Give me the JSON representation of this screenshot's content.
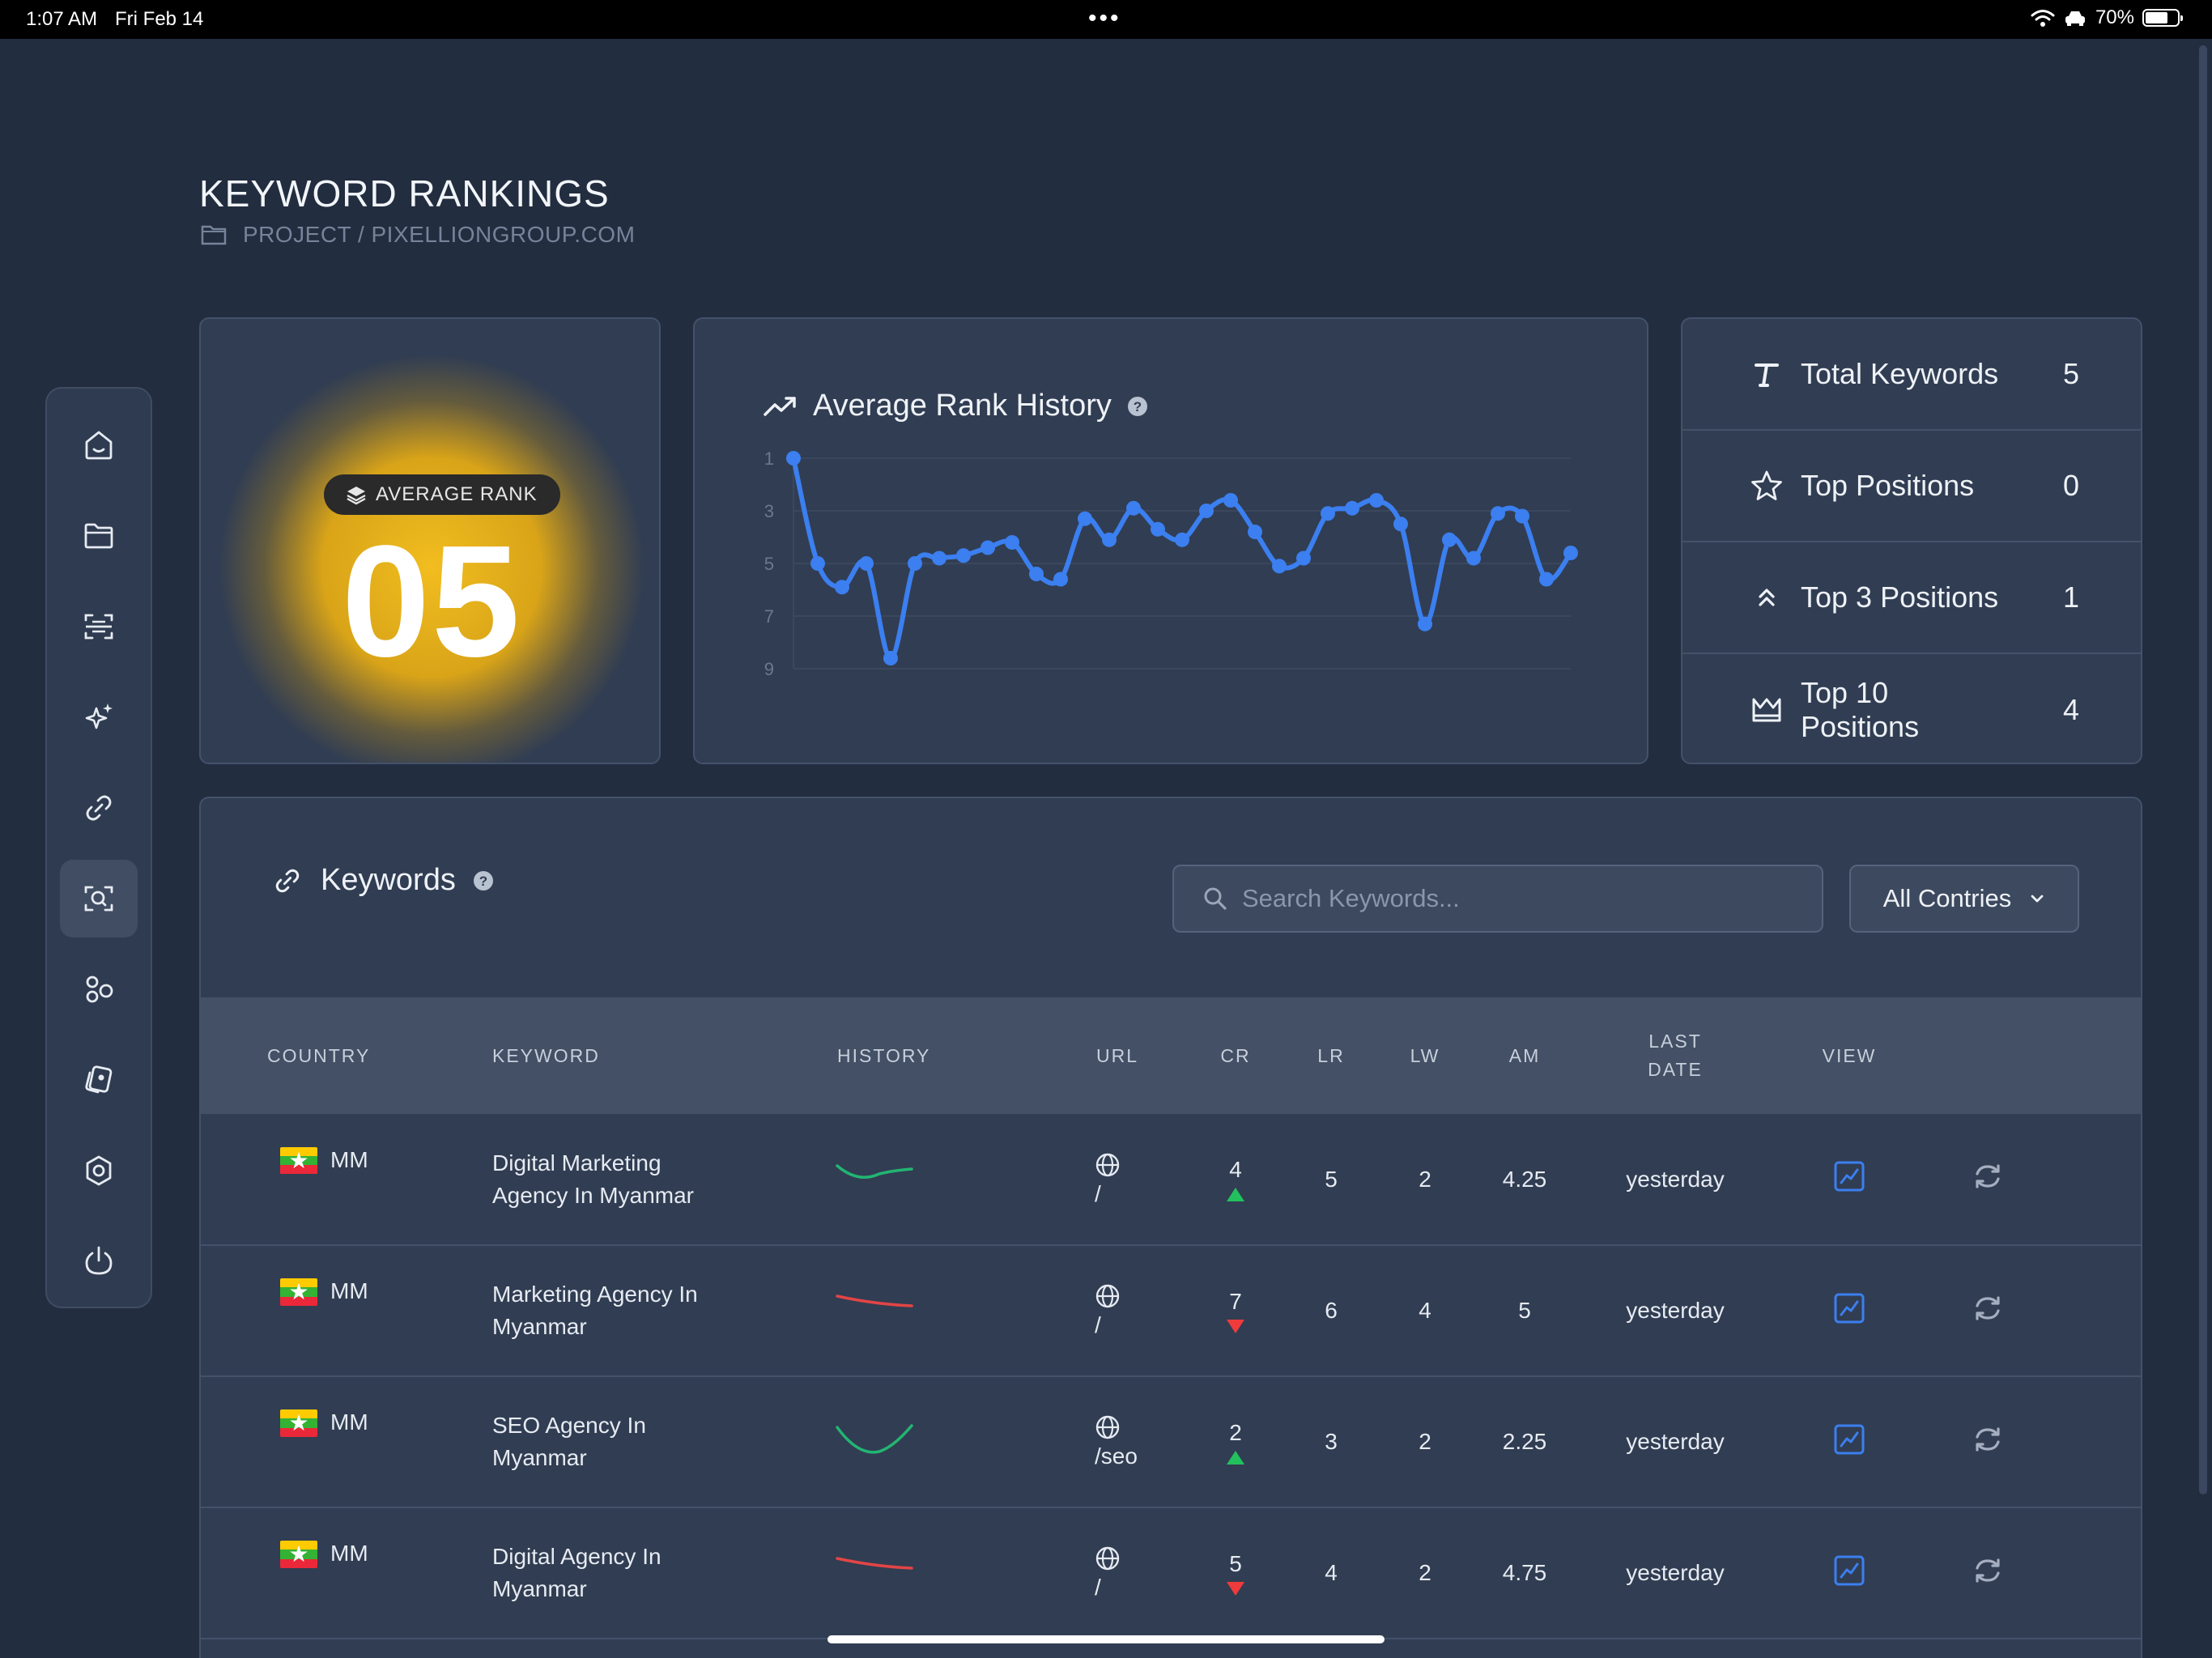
{
  "status_bar": {
    "time": "1:07 AM",
    "date": "Fri Feb 14",
    "battery": "70%",
    "battery_level": 0.7
  },
  "header": {
    "title": "KEYWORD RANKINGS",
    "breadcrumb": "PROJECT / PIXELLIONGROUP.COM"
  },
  "sidebar": {
    "items": [
      {
        "name": "home-icon",
        "active": false
      },
      {
        "name": "folder-icon",
        "active": false
      },
      {
        "name": "scan-icon",
        "active": false
      },
      {
        "name": "sparkles-icon",
        "active": false
      },
      {
        "name": "link-icon",
        "active": false
      },
      {
        "name": "search-scan-icon",
        "active": true
      },
      {
        "name": "shapes-icon",
        "active": false
      },
      {
        "name": "cards-icon",
        "active": false
      },
      {
        "name": "settings-icon",
        "active": false
      },
      {
        "name": "power-icon",
        "active": false
      }
    ]
  },
  "average_rank": {
    "badge_label": "AVERAGE RANK",
    "value": "05",
    "glow_color": "#f1bd1f"
  },
  "history": {
    "title": "Average Rank History",
    "help_icon": "question-circle-icon",
    "trend_icon": "trending-up-icon"
  },
  "chart_data": {
    "type": "line",
    "title": "Average Rank History",
    "y_ticks": [
      "1",
      "3",
      "5",
      "7",
      "9"
    ],
    "ylim": [
      1,
      9
    ],
    "y_inverted": true,
    "grid": true,
    "series": [
      {
        "color": "#3b7ff0",
        "values": [
          1,
          5.0,
          5.9,
          5.0,
          8.6,
          5.0,
          4.8,
          4.7,
          4.4,
          4.2,
          5.4,
          5.6,
          3.3,
          4.1,
          2.9,
          3.7,
          4.1,
          3.0,
          2.6,
          3.8,
          5.1,
          4.8,
          3.1,
          2.9,
          2.6,
          3.5,
          7.3,
          4.1,
          4.8,
          3.1,
          3.2,
          5.6,
          4.6
        ]
      }
    ]
  },
  "stats": [
    {
      "icon": "text-t-icon",
      "label": "Total Keywords",
      "value": "5"
    },
    {
      "icon": "star-icon",
      "label": "Top Positions",
      "value": "0"
    },
    {
      "icon": "double-chevron-up-icon",
      "label": "Top 3 Positions",
      "value": "1"
    },
    {
      "icon": "crown-icon",
      "label": "Top 10 Positions",
      "value": "4"
    }
  ],
  "keywords": {
    "title": "Keywords",
    "search_placeholder": "Search Keywords...",
    "country_filter": "All Contries",
    "columns": {
      "country": "COUNTRY",
      "keyword": "KEYWORD",
      "history": "HISTORY",
      "url": "URL",
      "cr": "CR",
      "lr": "LR",
      "lw": "LW",
      "am": "AM",
      "last_date_1": "LAST",
      "last_date_2": "DATE",
      "view": "VIEW"
    },
    "rows": [
      {
        "country": "MM",
        "keyword": "Digital Marketing Agency In Myanmar",
        "history_trend": "dip",
        "url": "/",
        "cr": "4",
        "cr_dir": "up",
        "lr": "5",
        "lw": "2",
        "am": "4.25",
        "last_date": "yesterday"
      },
      {
        "country": "MM",
        "keyword": "Marketing Agency In Myanmar",
        "history_trend": "down",
        "url": "/",
        "cr": "7",
        "cr_dir": "down",
        "lr": "6",
        "lw": "4",
        "am": "5",
        "last_date": "yesterday"
      },
      {
        "country": "MM",
        "keyword": "SEO Agency In Myanmar",
        "history_trend": "valley",
        "url": "/seo",
        "cr": "2",
        "cr_dir": "up",
        "lr": "3",
        "lw": "2",
        "am": "2.25",
        "last_date": "yesterday"
      },
      {
        "country": "MM",
        "keyword": "Digital Agency In Myanmar",
        "history_trend": "down",
        "url": "/",
        "cr": "5",
        "cr_dir": "down",
        "lr": "4",
        "lw": "2",
        "am": "4.75",
        "last_date": "yesterday"
      }
    ]
  },
  "colors": {
    "background": "#222d3f",
    "card": "#313d52",
    "accent_blue": "#3b7ff0",
    "up_green": "#23c05e",
    "down_red": "#ef3b3b"
  }
}
